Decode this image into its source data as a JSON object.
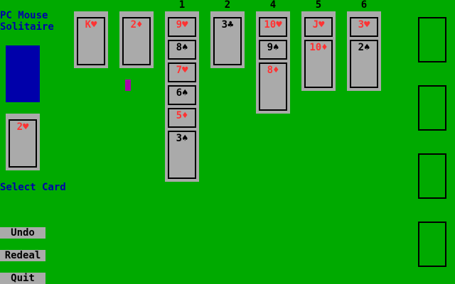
{
  "title": "PC Mouse\nSolitaire",
  "status": "Select Card",
  "buttons": {
    "undo": "Undo",
    "redeal": "Redeal",
    "quit": "Quit"
  },
  "waste": {
    "label": "2♥",
    "color": "red"
  },
  "top_row": [
    {
      "label": "K♥",
      "color": "red"
    },
    {
      "label": "2♦",
      "color": "red"
    }
  ],
  "columns": [
    {
      "number": "1",
      "cards": [
        {
          "label": "9♥",
          "color": "red"
        },
        {
          "label": "8♠",
          "color": "black"
        },
        {
          "label": "7♥",
          "color": "red"
        },
        {
          "label": "6♠",
          "color": "black"
        },
        {
          "label": "5♦",
          "color": "red"
        },
        {
          "label": "3♠",
          "color": "black"
        }
      ]
    },
    {
      "number": "2",
      "cards": [
        {
          "label": "3♣",
          "color": "black"
        }
      ]
    },
    {
      "number": "4",
      "cards": [
        {
          "label": "10♥",
          "color": "red"
        },
        {
          "label": "9♠",
          "color": "black"
        },
        {
          "label": "8♦",
          "color": "red"
        }
      ]
    },
    {
      "number": "5",
      "cards": [
        {
          "label": "J♥",
          "color": "red"
        },
        {
          "label": "10♦",
          "color": "red"
        }
      ]
    },
    {
      "number": "6",
      "cards": [
        {
          "label": "3♥",
          "color": "red"
        },
        {
          "label": "2♠",
          "color": "black"
        }
      ]
    }
  ],
  "colors": {
    "felt": "#00aa00",
    "card": "#aaaaaa",
    "deck": "#0000aa",
    "red_suit": "#ff3333",
    "cursor": "#aa00aa"
  }
}
